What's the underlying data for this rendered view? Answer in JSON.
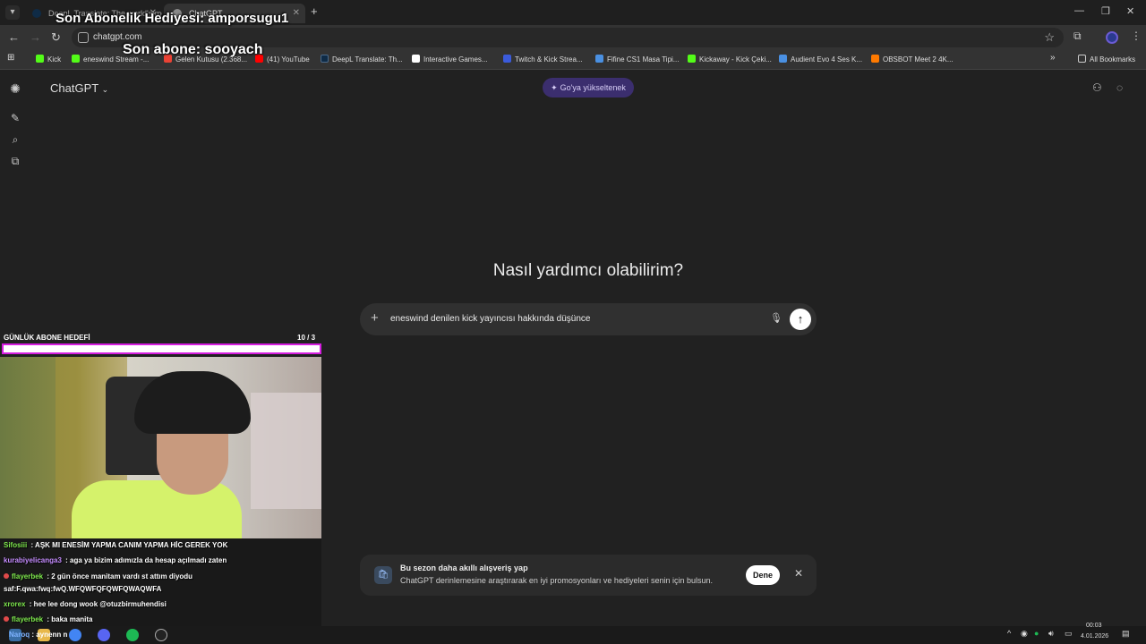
{
  "browser": {
    "tabs": [
      {
        "title": "DeepL Translate: The world's most accurate translator"
      },
      {
        "title": "ChatGPT"
      }
    ],
    "url": "chatgpt.com",
    "bookmarks": [
      {
        "label": "Kick",
        "color": "#53fc18"
      },
      {
        "label": "eneswind Stream -...",
        "color": "#53fc18"
      },
      {
        "label": "Gelen Kutusu (2.368...",
        "color": "#ea4335"
      },
      {
        "label": "(41) YouTube",
        "color": "#ff0000"
      },
      {
        "label": "DeepL Translate: Th...",
        "color": "#0f2b46"
      },
      {
        "label": "Interactive Games...",
        "color": "#ffffff"
      },
      {
        "label": "Twitch & Kick Strea...",
        "color": "#3b5bdb"
      },
      {
        "label": "Fifine CS1 Masa Tipi...",
        "color": "#4a90e2"
      },
      {
        "label": "Kickaway - Kick Çeki...",
        "color": "#53fc18"
      },
      {
        "label": "Audient Evo 4 Ses K...",
        "color": "#4a90e2"
      },
      {
        "label": "OBSBOT Meet 2 4K...",
        "color": "#ff7a00"
      }
    ],
    "all_bookmarks": "All Bookmarks"
  },
  "overlay": {
    "gift": "Son Abonelik Hediyesi: amporsugu1",
    "last_sub": "Son abone: sooyach",
    "goal_label": "GÜNLÜK ABONE HEDEFİ",
    "goal_count": "10  / 3",
    "goal_progress": 1.0,
    "chat": [
      {
        "user": "Sifosiii",
        "user_color": "#7ee84d",
        "text": " : AŞK MI ENESİM YAPMA CANIM YAPMA HİC GEREK YOK",
        "badge": false
      },
      {
        "user": "kurabiyelicanga3",
        "user_color": "#c58cff",
        "text": " : aga ya bizim adımızla da hesap açılmadı zaten",
        "badge": false
      },
      {
        "user": "flayerbek",
        "user_color": "#7ee84d",
        "text": " : 2 gün önce manitam vardı st attım diyodu",
        "badge": true
      },
      {
        "user": "",
        "user_color": "#ffffff",
        "text": "saf:F.qwa:fwq:fwQ.WFQWFQFQWFQWAQWFA",
        "badge": false
      },
      {
        "user": "xrorex",
        "user_color": "#7ee84d",
        "text": " : hee lee dong wook @otuzbirmuhendisi",
        "badge": false
      },
      {
        "user": "flayerbek",
        "user_color": "#7ee84d",
        "text": " : baka manita",
        "badge": true
      }
    ],
    "taskbar_chat": {
      "user": "Naroq",
      "text": " : aynenn n"
    }
  },
  "app": {
    "title": "ChatGPT",
    "upgrade": "Go'ya yükseltenek",
    "greeting": "Nasıl yardımcı olabilirim?",
    "prompt": "eneswind denilen kick yayıncısı hakkında düşünce",
    "promo": {
      "title": "Bu sezon daha akıllı alışveriş yap",
      "body": "ChatGPT derinlemesine araştırarak en iyi promosyonları ve hediyeleri senin için bulsun.",
      "button": "Dene"
    }
  },
  "taskbar": {
    "time": "00:03",
    "date": "4.01.2026"
  }
}
